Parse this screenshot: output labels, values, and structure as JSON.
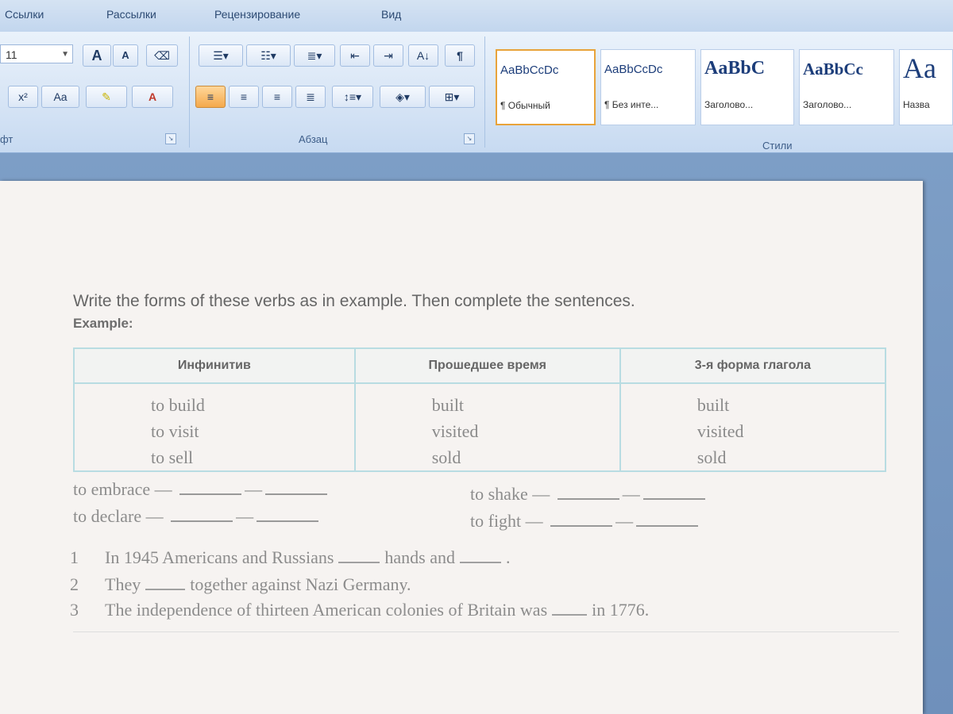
{
  "tabs": [
    "Ссылки",
    "Рассылки",
    "Рецензирование",
    "Вид"
  ],
  "font": {
    "size_value": "11",
    "grow_label": "A",
    "shrink_label": "A",
    "superscript_label": "x²",
    "case_label": "Aa",
    "color_label": "A",
    "group_label": "фт"
  },
  "paragraph": {
    "group_label": "Абзац",
    "icons": [
      "bullets-icon",
      "numbering-icon",
      "multilevel-list-icon",
      "decrease-indent-icon",
      "increase-indent-icon",
      "sort-icon",
      "show-marks-icon",
      "align-left-icon",
      "align-center-icon",
      "align-right-icon",
      "justify-icon",
      "line-spacing-icon",
      "shading-icon",
      "borders-icon"
    ],
    "sort_label": "A↓",
    "marks_label": "¶"
  },
  "styles": {
    "group_label": "Стили",
    "items": [
      {
        "preview": "AaBbCcDc",
        "name": "¶ Обычный"
      },
      {
        "preview": "AaBbCcDc",
        "name": "¶ Без инте..."
      },
      {
        "preview": "AaBbC",
        "name": "Заголово..."
      },
      {
        "preview": "AaBbCc",
        "name": "Заголово..."
      },
      {
        "preview": "Aa",
        "name": "Назва"
      }
    ]
  },
  "document": {
    "instruction": "Write the forms of these verbs as in example. Then complete the sentences.",
    "example_label": "Example:",
    "table": {
      "headers": [
        "Инфинитив",
        "Прошедшее время",
        "3-я форма глагола"
      ],
      "col1": [
        "to build",
        "to visit",
        "to sell"
      ],
      "col2": [
        "built",
        "visited",
        "sold"
      ],
      "col3": [
        "built",
        "visited",
        "sold"
      ]
    },
    "exercises": {
      "left": [
        "to embrace —",
        "to declare —"
      ],
      "right": [
        "to shake —",
        "to fight —"
      ],
      "dash": "—"
    },
    "sentences": [
      {
        "num": "1",
        "part1": "In 1945 Americans and Russians",
        "part2": "hands and",
        "end": "."
      },
      {
        "num": "2",
        "part1": "They",
        "part2": "together against Nazi Germany."
      },
      {
        "num": "3",
        "part1": "The independence of thirteen American colonies of Britain was",
        "part2": "in 1776."
      }
    ]
  }
}
